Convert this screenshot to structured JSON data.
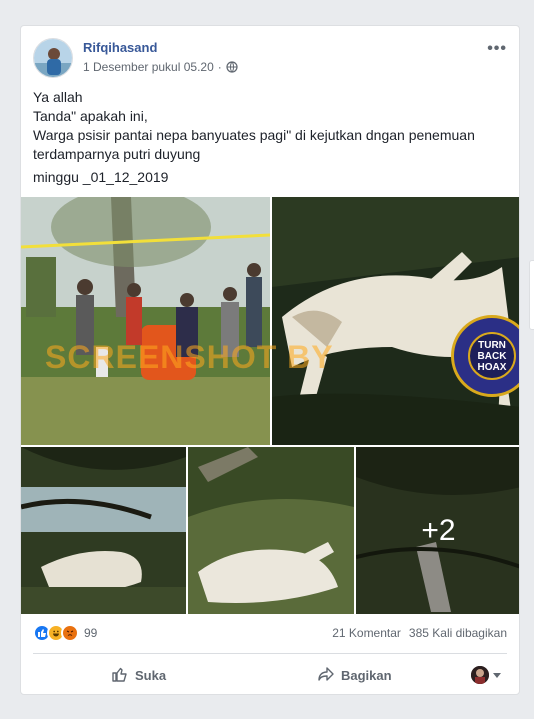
{
  "post": {
    "author": "Rifqihasand",
    "timestamp": "1 Desember pukul 05.20",
    "privacy_icon": "globe-icon",
    "more_icon": "more-options-icon",
    "text_lines": [
      "Ya allah",
      "Tanda\" apakah ini,",
      "Warga psisir pantai nepa banyuates pagi\" di kejutkan dngan penemuan terdamparnya putri duyung"
    ],
    "date_line": "minggu _01_12_2019"
  },
  "photos": {
    "watermark": "SCREENSHOT BY",
    "badge": {
      "line1": "TURN",
      "line2": "BACK",
      "line3": "HOAX"
    },
    "more_count": "+2"
  },
  "stats": {
    "reaction_icons": [
      "like-icon",
      "haha-icon",
      "angry-icon"
    ],
    "reaction_count": "99",
    "comments": "21 Komentar",
    "shares": "385 Kali dibagikan"
  },
  "actions": {
    "like_label": "Suka",
    "share_label": "Bagikan"
  },
  "colors": {
    "author_link": "#385898",
    "page_bg": "#e9ebee",
    "like_blue": "#1877f2"
  }
}
